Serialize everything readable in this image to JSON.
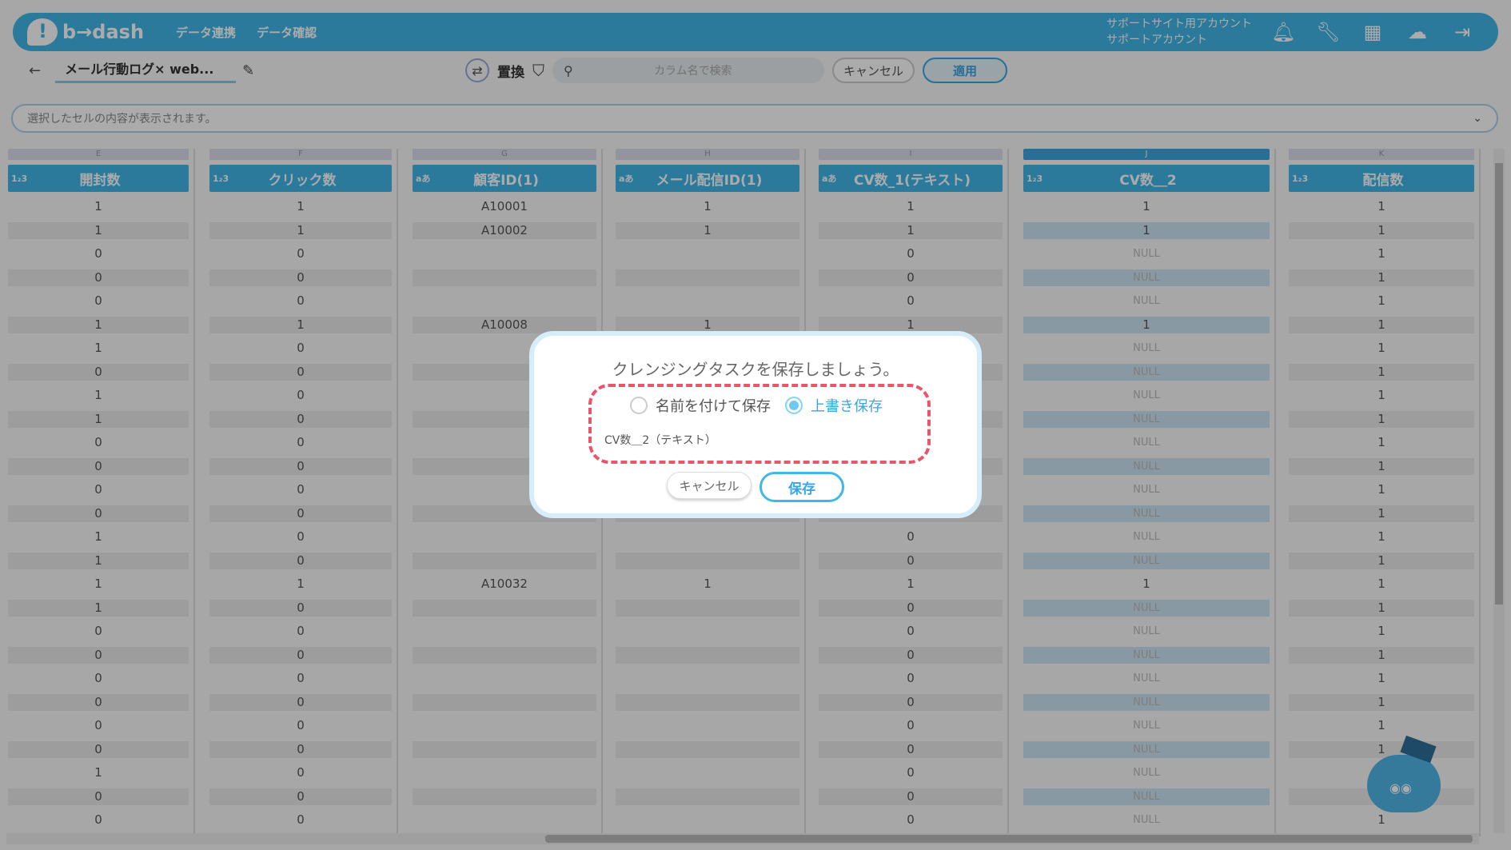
{
  "header": {
    "logo_text": "b→dash",
    "nav": [
      "データ連携",
      "データ確認"
    ],
    "account_line1": "サポートサイト用アカウント",
    "account_line2": "サポートアカウント",
    "icons": [
      "bell-icon",
      "wrench-icon",
      "apps-grid-icon",
      "mascot-icon",
      "logout-icon"
    ]
  },
  "toolbar": {
    "back": "←",
    "title": "メール行動ログ× web...",
    "replace_label": "置換",
    "search_placeholder": "カラム名で検索",
    "cancel_label": "キャンセル",
    "apply_label": "適用"
  },
  "cellbar": {
    "placeholder": "選択したセルの内容が表示されます。"
  },
  "columns": [
    {
      "letter": "E",
      "type": "1₂3",
      "name": "開封数",
      "values": [
        "1",
        "1",
        "0",
        "0",
        "0",
        "1",
        "1",
        "0",
        "1",
        "1",
        "0",
        "0",
        "0",
        "0",
        "1",
        "1",
        "1",
        "1",
        "0",
        "0",
        "0",
        "0",
        "0",
        "0",
        "1",
        "0",
        "0"
      ]
    },
    {
      "letter": "F",
      "type": "1₂3",
      "name": "クリック数",
      "values": [
        "1",
        "1",
        "0",
        "0",
        "0",
        "1",
        "0",
        "0",
        "0",
        "0",
        "0",
        "0",
        "0",
        "0",
        "0",
        "0",
        "1",
        "0",
        "0",
        "0",
        "0",
        "0",
        "0",
        "0",
        "0",
        "0",
        "0"
      ]
    },
    {
      "letter": "G",
      "type": "aあ",
      "name": "顧客ID(1)",
      "values": [
        "A10001",
        "A10002",
        "",
        "",
        "",
        "A10008",
        "",
        "",
        "",
        "",
        "",
        "",
        "",
        "",
        "",
        "",
        "A10032",
        "",
        "",
        "",
        "",
        "",
        "",
        "",
        "",
        "",
        ""
      ]
    },
    {
      "letter": "H",
      "type": "aあ",
      "name": "メール配信ID(1)",
      "values": [
        "1",
        "1",
        "",
        "",
        "",
        "1",
        "",
        "",
        "",
        "",
        "",
        "",
        "",
        "",
        "",
        "",
        "1",
        "",
        "",
        "",
        "",
        "",
        "",
        "",
        "",
        "",
        ""
      ]
    },
    {
      "letter": "I",
      "type": "aあ",
      "name": "CV数_1(テキスト)",
      "values": [
        "1",
        "1",
        "0",
        "0",
        "0",
        "1",
        "",
        "",
        "",
        "",
        "",
        "",
        "",
        "0",
        "0",
        "0",
        "1",
        "0",
        "0",
        "0",
        "0",
        "0",
        "0",
        "0",
        "0",
        "0",
        "0"
      ]
    },
    {
      "letter": "J",
      "type": "1₂3",
      "name": "CV数＿2",
      "values": [
        "1",
        "1",
        "NULL",
        "NULL",
        "NULL",
        "1",
        "NULL",
        "NULL",
        "NULL",
        "NULL",
        "NULL",
        "NULL",
        "NULL",
        "NULL",
        "NULL",
        "NULL",
        "1",
        "NULL",
        "NULL",
        "NULL",
        "NULL",
        "NULL",
        "NULL",
        "NULL",
        "NULL",
        "NULL",
        "NULL"
      ]
    },
    {
      "letter": "K",
      "type": "1₂3",
      "name": "配信数",
      "values": [
        "1",
        "1",
        "1",
        "1",
        "1",
        "1",
        "1",
        "1",
        "1",
        "1",
        "1",
        "1",
        "1",
        "1",
        "1",
        "1",
        "1",
        "1",
        "1",
        "1",
        "1",
        "1",
        "1",
        "1",
        "1",
        "1",
        "1"
      ]
    }
  ],
  "modal": {
    "title": "クレンジングタスクを保存しましょう。",
    "option_new": "名前を付けて保存",
    "option_overwrite": "上書き保存",
    "selected": "上書き保存",
    "name_value": "CV数＿2（テキスト）",
    "cancel_label": "キャンセル",
    "save_label": "保存"
  },
  "colors": {
    "brand": "#41b7e8",
    "highlight_dash": "#e8566b"
  }
}
